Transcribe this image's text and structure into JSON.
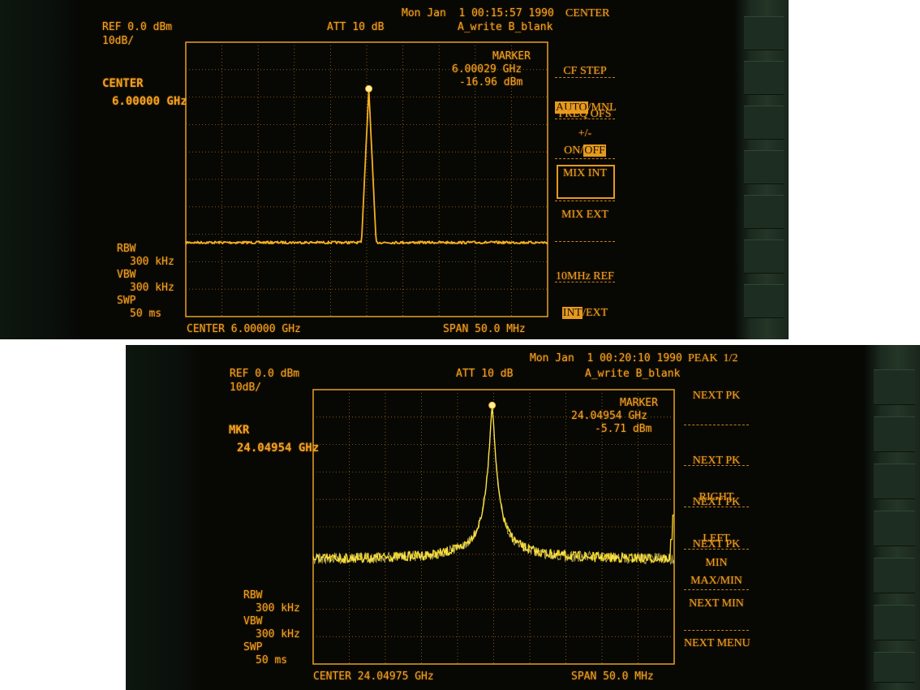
{
  "panels": [
    {
      "datetime": "Mon Jan  1 00:15:57 1990",
      "ref_level": "REF 0.0 dBm",
      "scale": "10dB/",
      "attenuation": "ATT 10 dB",
      "trace_modes": "A_write B_blank",
      "active_function": {
        "label": "CENTER",
        "value": "6.00000 GHz"
      },
      "marker": {
        "title": "MARKER",
        "frequency": "6.00029 GHz",
        "amplitude": "-16.96 dBm"
      },
      "bw": {
        "rbw_label": "RBW",
        "rbw_value": "300 kHz",
        "vbw_label": "VBW",
        "vbw_value": "300 kHz",
        "swp_label": "SWP",
        "swp_value": "50 ms"
      },
      "footer": {
        "center": "CENTER 6.00000 GHz",
        "span": "SPAN 50.0 MHz"
      },
      "menu_title": "CENTER",
      "softkeys": {
        "cf_step": {
          "title": "CF STEP",
          "opt_on": "AUTO",
          "sep": "/",
          "opt_off": "MNL",
          "active": "AUTO"
        },
        "freq_ofs": {
          "title": "FREQ OFS",
          "opt_on": "ON",
          "sep": "/",
          "opt_off": "OFF",
          "active": "OFF"
        },
        "plus_minus": "+/-",
        "mix_int": "MIX INT",
        "mix_ext": "MIX EXT",
        "ref_10mhz": {
          "title": "10MHz REF",
          "opt_on": "INT",
          "sep": "/",
          "opt_off": "EXT",
          "active": "INT"
        }
      },
      "trace_style": {
        "color": "#f5b01e",
        "peak_dbm": -16.96,
        "noise_floor_dbm": -73,
        "marker_color": "#fff3a0"
      }
    },
    {
      "datetime": "Mon Jan  1 00:20:10 1990",
      "ref_level": "REF 0.0 dBm",
      "scale": "10dB/",
      "attenuation": "ATT 10 dB",
      "trace_modes": "A_write B_blank",
      "active_function": {
        "label": "MKR",
        "value": "24.04954 GHz"
      },
      "marker": {
        "title": "MARKER",
        "frequency": "24.04954 GHz",
        "amplitude": "-5.71 dBm"
      },
      "bw": {
        "rbw_label": "RBW",
        "rbw_value": "300 kHz",
        "vbw_label": "VBW",
        "vbw_value": "300 kHz",
        "swp_label": "SWP",
        "swp_value": "50 ms"
      },
      "footer": {
        "center": "CENTER 24.04975 GHz",
        "span": "SPAN 50.0 MHz"
      },
      "menu_title": "PEAK  1/2",
      "softkeys": {
        "next_pk": "NEXT PK",
        "next_pk_right_1": "NEXT PK",
        "next_pk_right_2": "RIGHT",
        "next_pk_left_1": "NEXT PK",
        "next_pk_left_2": "LEFT",
        "next_pk_maxmin_1": "NEXT PK",
        "next_pk_maxmin_2": "MAX/MIN",
        "min": "MIN",
        "next_min": "NEXT MIN",
        "next_menu": "NEXT MENU"
      },
      "trace_style": {
        "color": "#f0d020",
        "peak_dbm": -5.71,
        "noise_floor_dbm": -62,
        "marker_color": "#fff3a0"
      }
    }
  ]
}
